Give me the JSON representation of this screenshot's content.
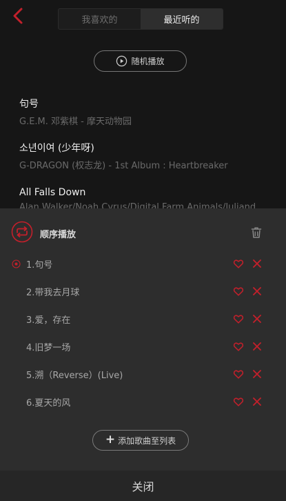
{
  "header": {
    "back_icon": "chevron-left-icon",
    "tabs": [
      {
        "label": "我喜欢的",
        "active": false
      },
      {
        "label": "最近听的",
        "active": true
      }
    ]
  },
  "shuffle": {
    "label": "随机播放",
    "icon": "play-circle-icon"
  },
  "recent_songs": [
    {
      "title": "句号",
      "meta": "G.E.M. 邓紫棋 - 摩天动物园"
    },
    {
      "title": "소년이여 (少年呀)",
      "meta": "G-DRAGON (权志龙) - 1st Album : Heartbreaker"
    },
    {
      "title": "All Falls Down",
      "meta": "Alan Walker/Noah Cyrus/Digital Farm Animals/Juliand"
    }
  ],
  "playlist_sheet": {
    "mode_label": "顺序播放",
    "mode_icon": "repeat-icon",
    "trash_icon": "trash-icon",
    "items": [
      {
        "label": "1.句号",
        "playing": true
      },
      {
        "label": "2.带我去月球",
        "playing": false
      },
      {
        "label": "3.爱，存在",
        "playing": false
      },
      {
        "label": "4.旧梦一场",
        "playing": false
      },
      {
        "label": "5.溯（Reverse）(Live)",
        "playing": false
      },
      {
        "label": "6.夏天的风",
        "playing": false
      }
    ],
    "add_label": "添加歌曲至列表",
    "add_icon": "plus-icon"
  },
  "close_label": "关闭",
  "colors": {
    "accent": "#c3202b",
    "background": "#161616",
    "sheet": "#2d2d2d"
  }
}
